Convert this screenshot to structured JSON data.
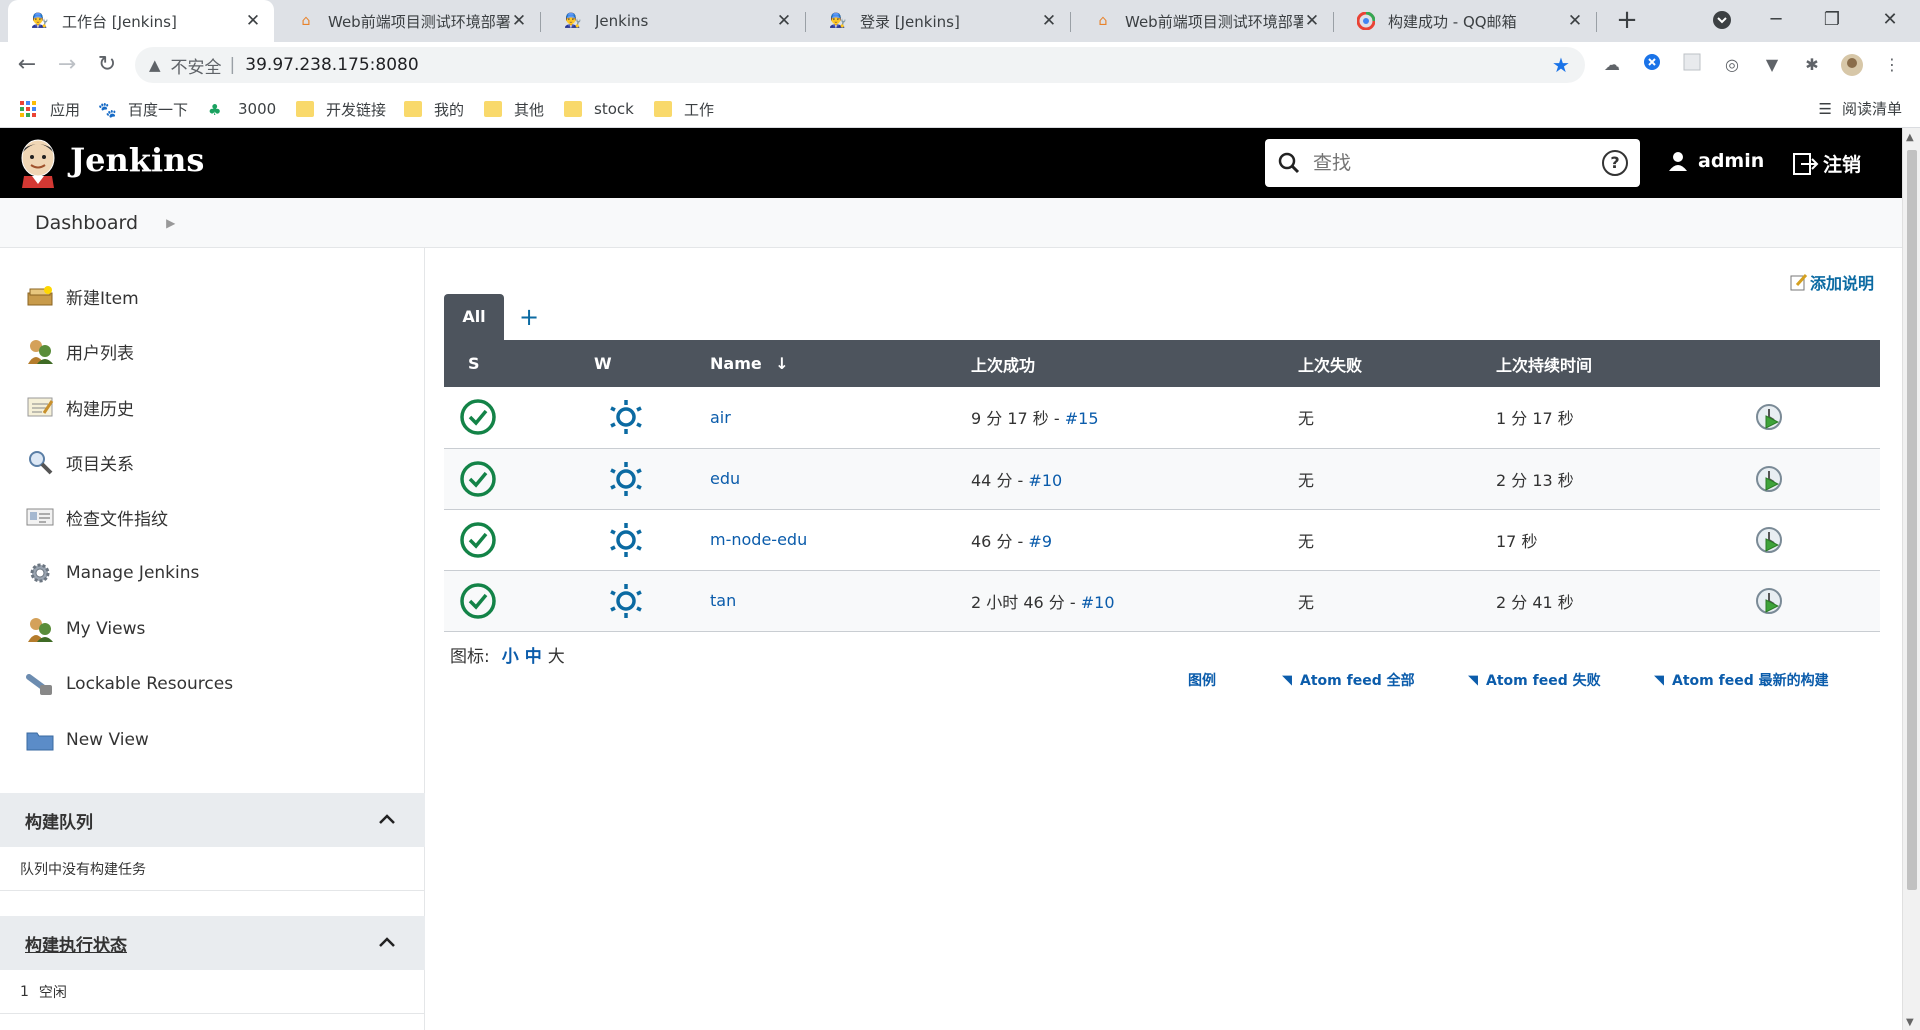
{
  "browser": {
    "tabs": [
      {
        "title": "工作台 [Jenkins]",
        "active": true,
        "favicon": "jenkins-favicon"
      },
      {
        "title": "Web前端项目测试环境部署",
        "active": false,
        "favicon": "home-favicon"
      },
      {
        "title": "Jenkins",
        "active": false,
        "favicon": "jenkins-favicon"
      },
      {
        "title": "登录 [Jenkins]",
        "active": false,
        "favicon": "jenkins-favicon"
      },
      {
        "title": "Web前端项目测试环境部署",
        "active": false,
        "favicon": "home-favicon"
      },
      {
        "title": "构建成功 - QQ邮箱",
        "active": false,
        "favicon": "qqmail-favicon"
      }
    ],
    "address": {
      "security_label": "不安全",
      "url": "39.97.238.175:8080"
    },
    "bookmarks": [
      {
        "label": "应用",
        "icon": "apps-grid-icon"
      },
      {
        "label": "百度一下",
        "icon": "baidu-paw-icon"
      },
      {
        "label": "3000",
        "icon": "leaf-icon"
      },
      {
        "label": "开发链接",
        "icon": "folder-icon"
      },
      {
        "label": "我的",
        "icon": "folder-icon"
      },
      {
        "label": "其他",
        "icon": "folder-icon"
      },
      {
        "label": "stock",
        "icon": "folder-icon"
      },
      {
        "label": "工作",
        "icon": "folder-icon"
      }
    ],
    "reading_list": "阅读清单"
  },
  "jenkins": {
    "brand": "Jenkins",
    "search_placeholder": "查找",
    "user": "admin",
    "logout": "注销",
    "breadcrumb": "Dashboard",
    "tasks": [
      {
        "label": "新建Item",
        "icon": "new-item-icon"
      },
      {
        "label": "用户列表",
        "icon": "users-icon"
      },
      {
        "label": "构建历史",
        "icon": "build-history-icon"
      },
      {
        "label": "项目关系",
        "icon": "magnifier-icon"
      },
      {
        "label": "检查文件指纹",
        "icon": "fingerprint-card-icon"
      },
      {
        "label": "Manage Jenkins",
        "icon": "gear-icon"
      },
      {
        "label": "My Views",
        "icon": "users-icon"
      },
      {
        "label": "Lockable Resources",
        "icon": "lock-resources-icon"
      },
      {
        "label": "New View",
        "icon": "folder-icon"
      }
    ],
    "build_queue": {
      "title": "构建队列",
      "empty": "队列中没有构建任务"
    },
    "executor_status": {
      "title": "构建执行状态",
      "rows": [
        {
          "num": "1",
          "state": "空闲"
        }
      ]
    },
    "add_description": "添加说明",
    "view_tab": "All",
    "columns": {
      "s": "S",
      "w": "W",
      "name": "Name",
      "sort_arrow": "↓",
      "last_success": "上次成功",
      "last_failure": "上次失败",
      "last_duration": "上次持续时间"
    },
    "jobs": [
      {
        "name": "air",
        "last_success_time": "9 分 17 秒 - ",
        "last_success_build": "#15",
        "last_failure": "无",
        "last_duration": "1 分 17 秒"
      },
      {
        "name": "edu",
        "last_success_time": "44 分 - ",
        "last_success_build": "#10",
        "last_failure": "无",
        "last_duration": "2 分 13 秒"
      },
      {
        "name": "m-node-edu",
        "last_success_time": "46 分 - ",
        "last_success_build": "#9",
        "last_failure": "无",
        "last_duration": "17 秒"
      },
      {
        "name": "tan",
        "last_success_time": "2 小时 46 分 - ",
        "last_success_build": "#10",
        "last_failure": "无",
        "last_duration": "2 分 41 秒"
      }
    ],
    "icon_size": {
      "label": "图标:",
      "small": "小",
      "medium": "中",
      "large": "大"
    },
    "footer_links": {
      "legend": "图例",
      "feed_all": "Atom feed 全部",
      "feed_failed": "Atom feed 失败",
      "feed_latest": "Atom feed 最新的构建"
    },
    "colors": {
      "header_bg": "#000000",
      "table_header_bg": "#4d545d",
      "success_green": "#138347",
      "weather_blue": "#0b6aa2",
      "link_blue": "#0b5cab"
    }
  }
}
